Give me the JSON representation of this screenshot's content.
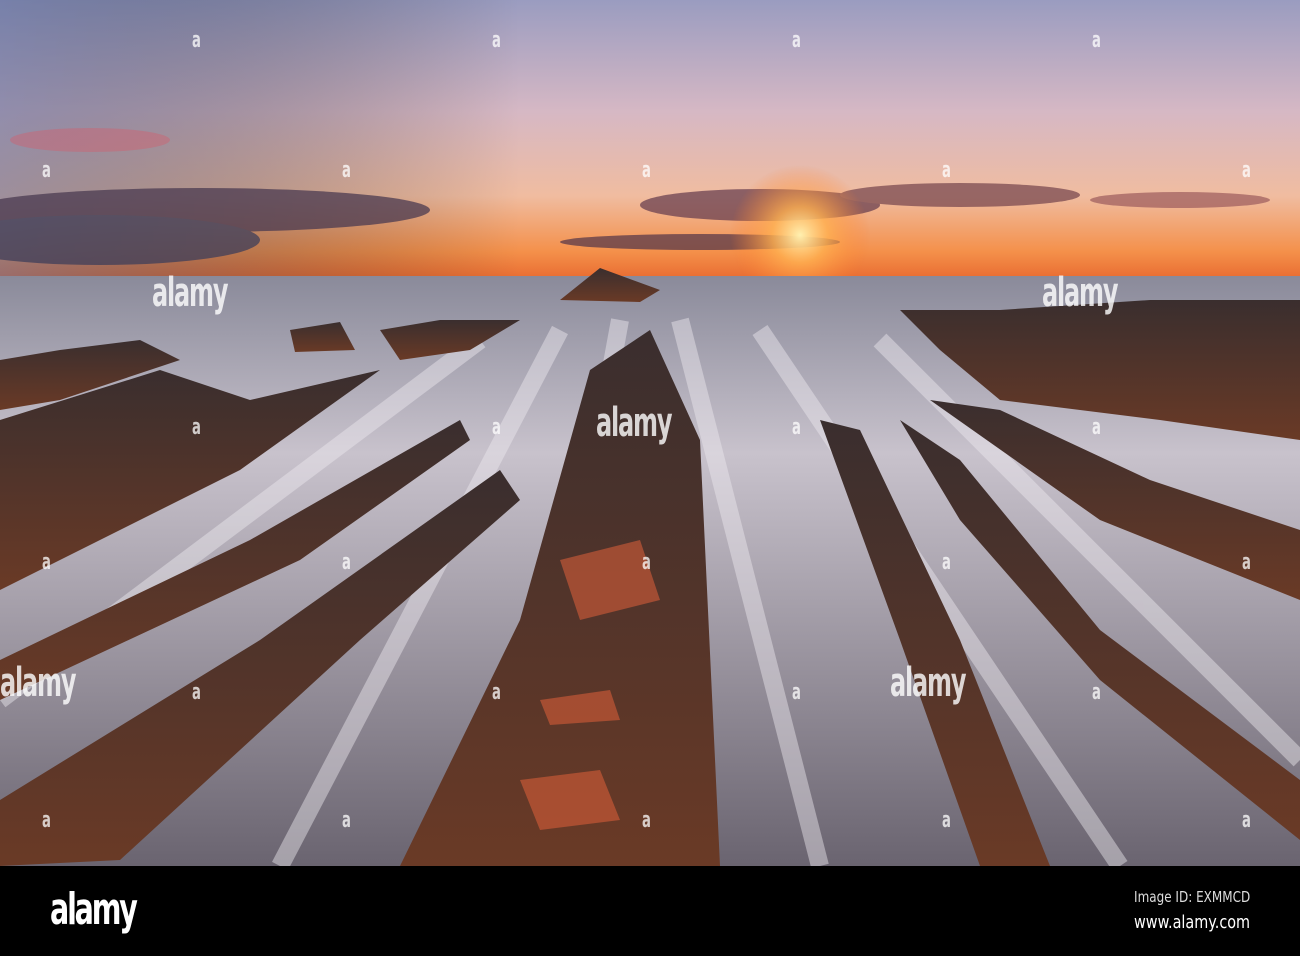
{
  "photo": {
    "watermark_glyph": "a",
    "watermark_word": "alamy",
    "colors": {
      "sky_top": "#8a8fb0",
      "sky_mid": "#d8b8c0",
      "horizon": "#f08a40",
      "sun": "#ffe090",
      "rock": "#5a3a2e",
      "water": "#c8c4cc"
    }
  },
  "footer": {
    "logo": "alamy",
    "image_id": "Image ID: EXMMCD",
    "website": "www.alamy.com"
  }
}
